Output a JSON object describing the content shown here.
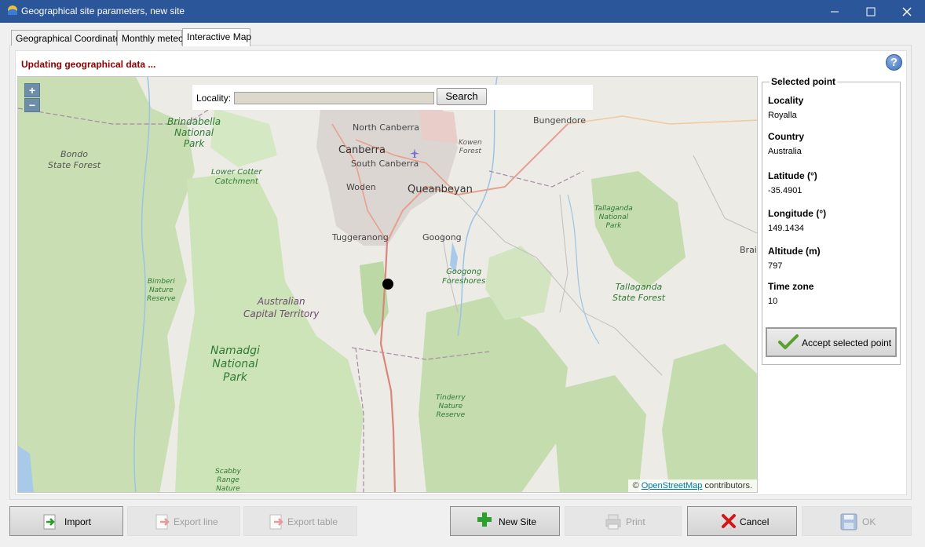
{
  "window": {
    "title": "Geographical site parameters, new site",
    "controls": {
      "minimize": "minimize-icon",
      "maximize": "maximize-icon",
      "close": "close-icon"
    }
  },
  "tabs": [
    {
      "label": "Geographical Coordinates",
      "active": false
    },
    {
      "label": "Monthly meteo",
      "active": false
    },
    {
      "label": "Interactive Map",
      "active": true
    }
  ],
  "status": "Updating geographical data ...",
  "help_icon": "?",
  "map": {
    "zoom_in": "+",
    "zoom_out": "−",
    "locality_label": "Locality:",
    "locality_value": "",
    "search_label": "Search",
    "attribution_prefix": "©",
    "attribution_link": "OpenStreetMap",
    "attribution_suffix": "contributors.",
    "labels": {
      "north_canberra": "North Canberra",
      "canberra": "Canberra",
      "south_canberra": "South Canberra",
      "woden": "Woden",
      "queanbeyan": "Queanbeyan",
      "tuggeranong": "Tuggeranong",
      "googong": "Googong",
      "bungendore": "Bungendore",
      "braid": "Braid",
      "kowen_forest": "Kowen\nForest",
      "brindabella": "Brindabella\nNational\nPark",
      "bondo": "Bondo\nState Forest",
      "lower_cotter": "Lower Cotter\nCatchment",
      "bimberi": "Bimberi\nNature\nReserve",
      "act": "Australian\nCapital Territory",
      "namadgi": "Namadgi\nNational\nPark",
      "googong_foreshores": "Googong\nForeshores",
      "tallaganda_np": "Tallaganda\nNational\nPark",
      "tallaganda_sf": "Tallaganda\nState Forest",
      "tinderry": "Tinderry\nNature\nReserve",
      "scabby": "Scabby\nRange\nNature"
    }
  },
  "selected_point": {
    "legend": "Selected point",
    "fields": [
      {
        "label": "Locality",
        "value": "Royalla"
      },
      {
        "label": "Country",
        "value": "Australia"
      },
      {
        "label": "Latitude (°)",
        "value": "-35.4901"
      },
      {
        "label": "Longitude (°)",
        "value": "149.1434"
      },
      {
        "label": "Altitude (m)",
        "value": "797"
      },
      {
        "label": "Time zone",
        "value": "10"
      }
    ],
    "accept_label": "Accept selected point"
  },
  "buttons": {
    "import": "Import",
    "export_line": "Export line",
    "export_table": "Export table",
    "new_site": "New Site",
    "print": "Print",
    "cancel": "Cancel",
    "ok": "OK"
  },
  "colors": {
    "titlebar": "#2b579a",
    "status": "#8b0000",
    "park_green": "#c8dfb4",
    "urban": "#dcd6d3",
    "water": "#a9c9e8",
    "road_red": "#d9877c"
  }
}
